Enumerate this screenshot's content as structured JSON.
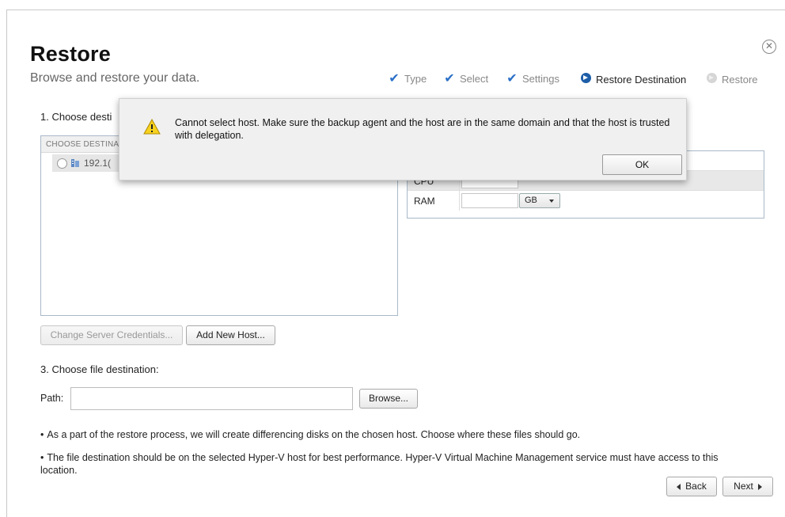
{
  "header": {
    "title": "Restore",
    "subtitle": "Browse and restore your data.",
    "close_symbol": "✕"
  },
  "steps": [
    {
      "label": "Type",
      "state": "done",
      "icon": "check-icon"
    },
    {
      "label": "Select",
      "state": "done",
      "icon": "check-icon"
    },
    {
      "label": "Settings",
      "state": "done",
      "icon": "check-icon"
    },
    {
      "label": "Restore Destination",
      "state": "current",
      "icon": "arrow-circle-icon"
    },
    {
      "label": "Restore",
      "state": "pending",
      "icon": "arrow-circle-icon"
    }
  ],
  "section1": {
    "label": "1. Choose desti",
    "list_header": "CHOOSE DESTINA",
    "host": "192.1("
  },
  "resources": {
    "rows": [
      {
        "label": "CPU",
        "value": ""
      },
      {
        "label": "RAM",
        "value": "",
        "unit": "GB"
      }
    ]
  },
  "buttons": {
    "change_credentials": "Change Server Credentials...",
    "add_host": "Add New Host...",
    "browse": "Browse...",
    "back": "Back",
    "next": "Next"
  },
  "section3": {
    "label": "3. Choose file destination:",
    "path_label": "Path:",
    "path_value": ""
  },
  "notes": [
    "As a part of the restore process, we will create differencing disks on the chosen host. Choose where these files should go.",
    "The file destination should be on the selected Hyper-V host for best performance. Hyper-V Virtual Machine Management service must have access to this location."
  ],
  "dialog": {
    "message": "Cannot select host. Make sure the backup agent and the host are in the same domain and that the host is trusted with delegation.",
    "ok_label": "OK",
    "icon": "warning-icon"
  },
  "colors": {
    "accent": "#2a6fc7",
    "current_step": "#1e5ea8",
    "warning": "#f7d21e"
  }
}
